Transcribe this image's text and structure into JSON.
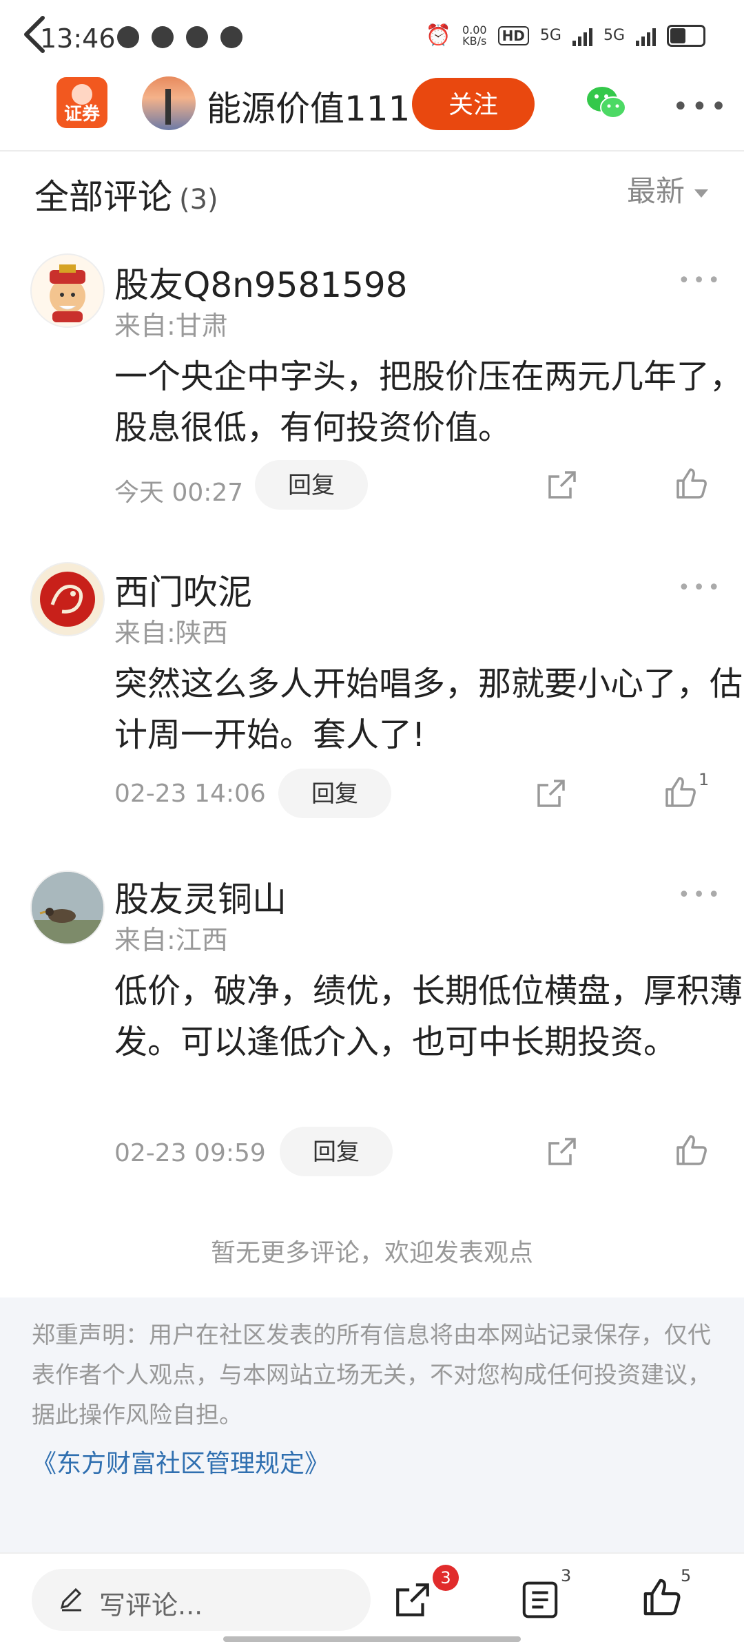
{
  "status_bar": {
    "time": "13:46",
    "net_speed": "0.00",
    "net_unit": "KB/s",
    "hd": "HD",
    "sim1": "5G",
    "sim2": "5G"
  },
  "nav": {
    "back_icon": "chevron-left-icon",
    "app_logo_label": "证券",
    "username": "能源价值111",
    "follow_label": "关注",
    "wechat_icon": "wechat-icon",
    "more_icon": "more-icon"
  },
  "section": {
    "title": "全部评论",
    "count": "(3)",
    "sort_label": "最新"
  },
  "comments": [
    {
      "author": "股友Q8n9581598",
      "from": "来自:甘肃",
      "text": "一个央企中字头，把股价压在两元几年了，股息很低，有何投资价值。",
      "time": "今天 00:27",
      "reply": "回复",
      "likes": ""
    },
    {
      "author": "西门吹泥",
      "from": "来自:陕西",
      "text": "突然这么多人开始唱多，那就要小心了，估计周一开始。套人了!",
      "time": "02-23 14:06",
      "reply": "回复",
      "likes": "1"
    },
    {
      "author": "股友灵铜山",
      "from": "来自:江西",
      "text": "低价，破净，绩优，长期低位横盘，厚积薄发。可以逢低介入，也可中长期投资。",
      "time": "02-23 09:59",
      "reply": "回复",
      "likes": ""
    }
  ],
  "no_more": "暂无更多评论，欢迎发表观点",
  "disclaimer": {
    "text": "郑重声明：用户在社区发表的所有信息将由本网站记录保存，仅代表作者个人观点，与本网站立场无关，不对您构成任何投资建议，据此操作风险自担。",
    "link": "《东方财富社区管理规定》"
  },
  "bottom_bar": {
    "input_placeholder": "写评论...",
    "share_badge": "3",
    "comment_count": "3",
    "like_count": "5"
  },
  "colors": {
    "accent": "#e9480f",
    "link": "#2f6fb0"
  }
}
